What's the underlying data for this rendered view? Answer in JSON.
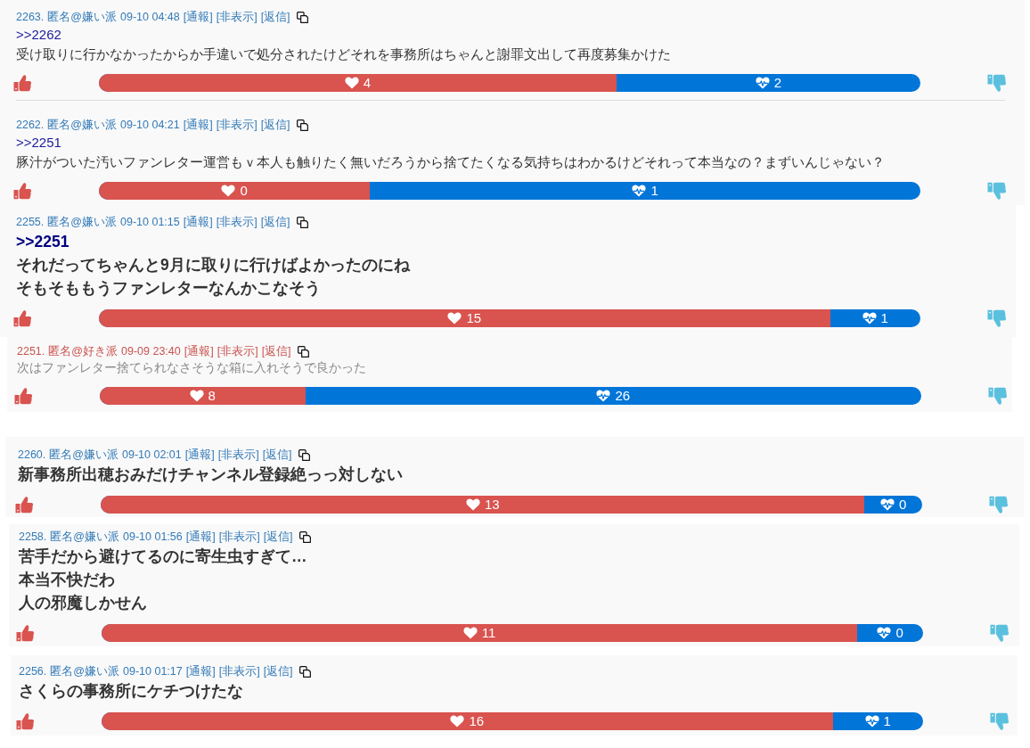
{
  "groups": [
    {
      "posts": [
        {
          "kind": "normal",
          "number": "2263.",
          "author": "匿名@嫌い派",
          "time": "09-10 04:48",
          "color": "#337ab7",
          "actions": [
            "[通報]",
            "[非表示]",
            "[返信]"
          ],
          "reply_to": ">>2262",
          "lines": [
            "受け取りに行かなかったからか手違いで処分されたけどそれを事務所はちゃんと謝罪文出して再度募集かけた"
          ],
          "likes": "4",
          "dislikes": "2",
          "level": 0.63
        },
        {
          "kind": "normal",
          "number": "2262.",
          "author": "匿名@嫌い派",
          "time": "09-10 04:21",
          "color": "#337ab7",
          "actions": [
            "[通報]",
            "[非表示]",
            "[返信]"
          ],
          "reply_to": ">>2251",
          "lines": [
            "豚汁がついた汚いファンレター運営もｖ本人も触りたく無いだろうから捨てたくなる気持ちはわかるけどそれって本当なの？まずいんじゃない？"
          ],
          "likes": "0",
          "dislikes": "1",
          "level": 0.33
        }
      ]
    },
    {
      "posts": [
        {
          "kind": "bold",
          "number": "2255.",
          "author": "匿名@嫌い派",
          "time": "09-10 01:15",
          "color": "#337ab7",
          "actions": [
            "[通報]",
            "[非表示]",
            "[返信]"
          ],
          "reply_to": ">>2251",
          "lines": [
            "それだってちゃんと9月に取りに行けばよかったのにね",
            "そもそももうファンレターなんかこなそう"
          ],
          "likes": "15",
          "dislikes": "1",
          "level": 0.89
        }
      ]
    },
    {
      "posts": [
        {
          "kind": "muted",
          "number": "2251.",
          "author": "匿名@好き派",
          "time": "09-09 23:40",
          "color": "#c9534f",
          "actions": [
            "[通報]",
            "[非表示]",
            "[返信]"
          ],
          "lines": [
            "次はファンレター捨てられなさそうな箱に入れそうで良かった"
          ],
          "likes": "8",
          "dislikes": "26",
          "level": 0.25
        }
      ]
    },
    {
      "posts": [
        {
          "kind": "bold",
          "number": "2260.",
          "author": "匿名@嫌い派",
          "time": "09-10 02:01",
          "color": "#337ab7",
          "actions": [
            "[通報]",
            "[非表示]",
            "[返信]"
          ],
          "lines": [
            "新事務所出穂おみだけチャンネル登録絶っっ対しない"
          ],
          "likes": "13",
          "dislikes": "0",
          "level": 0.93
        }
      ]
    },
    {
      "posts": [
        {
          "kind": "bold",
          "number": "2258.",
          "author": "匿名@嫌い派",
          "time": "09-10 01:56",
          "color": "#337ab7",
          "actions": [
            "[通報]",
            "[非表示]",
            "[返信]"
          ],
          "lines": [
            "苦手だから避けてるのに寄生虫すぎて…",
            "本当不快だわ",
            "人の邪魔しかせん"
          ],
          "likes": "11",
          "dislikes": "0",
          "level": 0.92
        }
      ]
    },
    {
      "posts": [
        {
          "kind": "bold",
          "number": "2256.",
          "author": "匿名@嫌い派",
          "time": "09-10 01:17",
          "color": "#337ab7",
          "actions": [
            "[通報]",
            "[非表示]",
            "[返信]"
          ],
          "lines": [
            "さくらの事務所にケチつけたな"
          ],
          "likes": "16",
          "dislikes": "1",
          "level": 0.89
        }
      ]
    }
  ]
}
